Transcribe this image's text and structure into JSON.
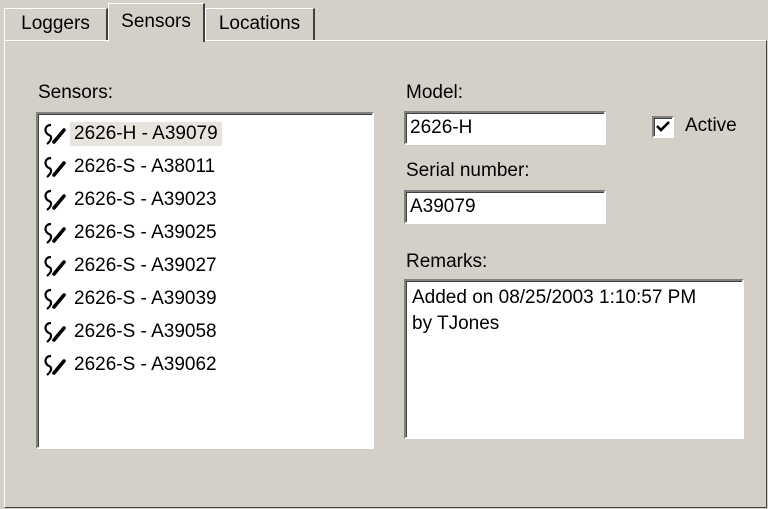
{
  "tabs": [
    {
      "label": "Loggers",
      "active": false
    },
    {
      "label": "Sensors",
      "active": true
    },
    {
      "label": "Locations",
      "active": false
    }
  ],
  "sensors": {
    "label": "Sensors:",
    "items": [
      {
        "label": "2626-H - A39079",
        "selected": true
      },
      {
        "label": "2626-S - A38011",
        "selected": false
      },
      {
        "label": "2626-S - A39023",
        "selected": false
      },
      {
        "label": "2626-S - A39025",
        "selected": false
      },
      {
        "label": "2626-S - A39027",
        "selected": false
      },
      {
        "label": "2626-S - A39039",
        "selected": false
      },
      {
        "label": "2626-S - A39058",
        "selected": false
      },
      {
        "label": "2626-S - A39062",
        "selected": false
      }
    ],
    "item_icon": "sensor-probe-icon"
  },
  "model": {
    "label": "Model:",
    "value": "2626-H"
  },
  "active": {
    "label": "Active",
    "checked": true
  },
  "serial": {
    "label": "Serial number:",
    "value": "A39079"
  },
  "remarks": {
    "label": "Remarks:",
    "value": "Added on 08/25/2003 1:10:57 PM\nby TJones"
  }
}
